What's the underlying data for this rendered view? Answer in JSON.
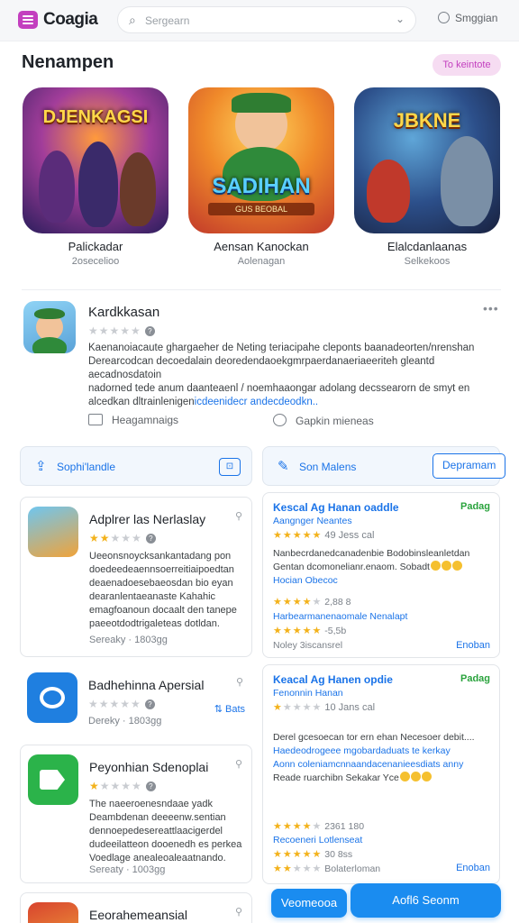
{
  "header": {
    "app_name": "Coagia",
    "search_placeholder": "Sergearn",
    "signin_label": "Smggian"
  },
  "featured": {
    "title": "Nenampen",
    "pill_label": "To keintote",
    "items": [
      {
        "name": "Palickadar",
        "sub": "2osecelioo",
        "art_title": "DJENKAGSI",
        "art_sub": ""
      },
      {
        "name": "Aensan Kanockan",
        "sub": "Aolenagan",
        "art_title": "SADIHAN",
        "art_sub": "GUS BEOBAL"
      },
      {
        "name": "Elalcdanlaanas",
        "sub": "Selkekoos",
        "art_title": "JBKNE",
        "art_sub": ""
      }
    ]
  },
  "detail": {
    "title": "Kardkkasan",
    "rating_stars": 0,
    "more_label": "•••",
    "description_lines": [
      "Kaenanoiacaute ghargaeher de Neting teriacipahe cleponts baanadeorten/nrenshan",
      "Derearcodcan decoedalain deoredendaoekgmrpaerdanaeriaeeriteh gleantd aecadnosdatoin",
      "nadorned tede anum daanteaenl / noemhaaongar adolang decssearorn de smyt en",
      "alcedkan dltrainlenigen"
    ],
    "description_link": "icdeenidecr andecdeodkn..",
    "meta_left": "Heagamnaigs",
    "meta_right": "Gapkin mieneas"
  },
  "action_left": {
    "label": "Sophi'landle"
  },
  "action_right": {
    "label": "Son Malens",
    "button": "Depramam"
  },
  "list": [
    {
      "title": "Adplrer las Nerlaslay",
      "rating_stars": 2,
      "body_lines": [
        "Ueeonsnoycksankantadang pon",
        "doedeedeaennsoerreitiaipoedtan",
        "deaenadoesebaeosdan bio eyan",
        "dearanlentaeanaste Kahahic",
        "emagfoanoun docaalt den tanepe",
        "paeeotdodtrigaleteas dotldan."
      ],
      "footer": "Sereaky · 1803gg"
    },
    {
      "title": "Badhehinna Apersial",
      "rating_stars": 0,
      "badge": "Bats",
      "footer": "Dereky · 1803gg"
    },
    {
      "title": "Peyonhian Sdenoplai",
      "rating_stars": 1,
      "body_lines": [
        "The naeeroenesndaae yadk",
        "Deambdenan deeeenw.sentian",
        "dennoepedesereattlaacigerdel",
        "dudeeilatteon dooenedh es perkea",
        "Voedlage anealeoaleaatnando."
      ],
      "footer": "Sereaty · 1003gg"
    },
    {
      "title": "Eeorahemeansial",
      "rating_stars": 0,
      "footer": ""
    }
  ],
  "reviews": [
    {
      "title": "Kescal Ag Hanan oaddle",
      "tag": "Padag",
      "sub": "Aangnger Neantes",
      "rating_stars": 5,
      "rating_count": "49 Jess cal",
      "text_lines": [
        "Nanbecrdanedcanadenbie Bodobinsleanletdan",
        "Gentan dcomonelianr.enaom. Sobadt"
      ],
      "text_link_line": "Hocian Obecoc",
      "row2_stars": 4,
      "row2_count": "2,88 8",
      "row2_link": "Harbearmanenaomale Nenalapt",
      "row3_stars": 5,
      "row3_count": "-5,5b",
      "footer_left": "Noley 3iscansrel",
      "footer_right": "Enoban"
    },
    {
      "title": "Keacal Ag Hanen opdie",
      "tag": "Padag",
      "sub": "Fenonnin Hanan",
      "rating_stars": 1,
      "rating_count": "10 Jans cal",
      "text_lines": [
        "Derel gcesoecan tor ern ehan Necesoer debit....",
        "Haedeodrogeee mgobardaduats te kerkay",
        "Aonn coleniamcnnaandacenanieesdiats anny",
        "Reade ruarchibn Sekakar Yce"
      ],
      "row2_stars": 4,
      "row2_count": "2361 180",
      "row2_link": "Recoeneri Lotlenseat",
      "row3_stars": 5,
      "row3_count": "30 8ss",
      "row4_stars": 2,
      "row4_count": "Bolaterloman",
      "footer_right": "Enoban"
    }
  ],
  "bottom": {
    "left_button": "Veomeooa",
    "right_button": "Aofl6 Seonm"
  },
  "colors": {
    "accent": "#1a73e8",
    "brand": "#c33fbf",
    "tag_green": "#2aa33d",
    "star": "#f3b21b"
  }
}
